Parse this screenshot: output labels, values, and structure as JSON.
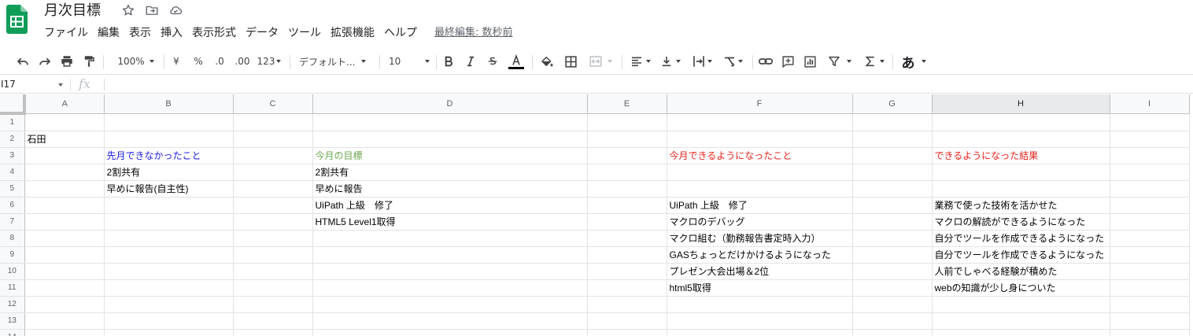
{
  "app": {
    "title": "月次目標",
    "last_edit": "最終編集: 数秒前",
    "menu": [
      "ファイル",
      "編集",
      "表示",
      "挿入",
      "表示形式",
      "データ",
      "ツール",
      "拡張機能",
      "ヘルプ"
    ]
  },
  "toolbar": {
    "zoom": "100%",
    "currency": "¥",
    "percent": "%",
    "decimal_decrease": ".0",
    "decimal_increase": ".00",
    "more_formats": "123",
    "font": "デフォルト...",
    "font_size": "10",
    "input_tools": "あ"
  },
  "formula_bar": {
    "name_box": "I17",
    "fx": "fx",
    "value": ""
  },
  "sheet": {
    "columns": [
      "A",
      "B",
      "C",
      "D",
      "E",
      "F",
      "G",
      "H",
      "I"
    ],
    "rows": [
      [
        "",
        "",
        "",
        "",
        "",
        "",
        "",
        "",
        ""
      ],
      [
        "石田",
        "",
        "",
        "",
        "",
        "",
        "",
        "",
        ""
      ],
      [
        "",
        "先月できなかったこと",
        "",
        "今月の目標",
        "",
        "今月できるようになったこと",
        "",
        "できるようになった結果",
        ""
      ],
      [
        "",
        "2割共有",
        "",
        "2割共有",
        "",
        "",
        "",
        "",
        ""
      ],
      [
        "",
        "早めに報告(自主性)",
        "",
        "早めに報告",
        "",
        "",
        "",
        "",
        ""
      ],
      [
        "",
        "",
        "",
        "UiPath 上級　修了",
        "",
        "UiPath 上級　修了",
        "",
        "業務で使った技術を活かせた",
        ""
      ],
      [
        "",
        "",
        "",
        "HTML5 Level1取得",
        "",
        "マクロのデバッグ",
        "",
        "マクロの解読ができるようになった",
        ""
      ],
      [
        "",
        "",
        "",
        "",
        "",
        "マクロ組む（勤務報告書定時入力）",
        "",
        "自分でツールを作成できるようになった",
        ""
      ],
      [
        "",
        "",
        "",
        "",
        "",
        "GASちょっとだけかけるようになった",
        "",
        "自分でツールを作成できるようになった",
        ""
      ],
      [
        "",
        "",
        "",
        "",
        "",
        "プレゼン大会出場＆2位",
        "",
        "人前でしゃべる経験が積めた",
        ""
      ],
      [
        "",
        "",
        "",
        "",
        "",
        "html5取得",
        "",
        "webの知識が少し身についた",
        ""
      ],
      [
        "",
        "",
        "",
        "",
        "",
        "",
        "",
        "",
        ""
      ],
      [
        "",
        "",
        "",
        "",
        "",
        "",
        "",
        "",
        ""
      ],
      [
        "",
        "",
        "",
        "",
        "",
        "",
        "",
        "",
        ""
      ]
    ],
    "header_colors": {
      "B3": "#1a1ae8",
      "D3": "#6aa84f",
      "F3": "#e8221a",
      "H3": "#e8221a"
    },
    "selected_column": "H"
  },
  "colors": {
    "sheets_green": "#0f9d58",
    "text_blue": "#1a1ae8",
    "text_green": "#6aa84f",
    "text_red": "#e8221a"
  }
}
